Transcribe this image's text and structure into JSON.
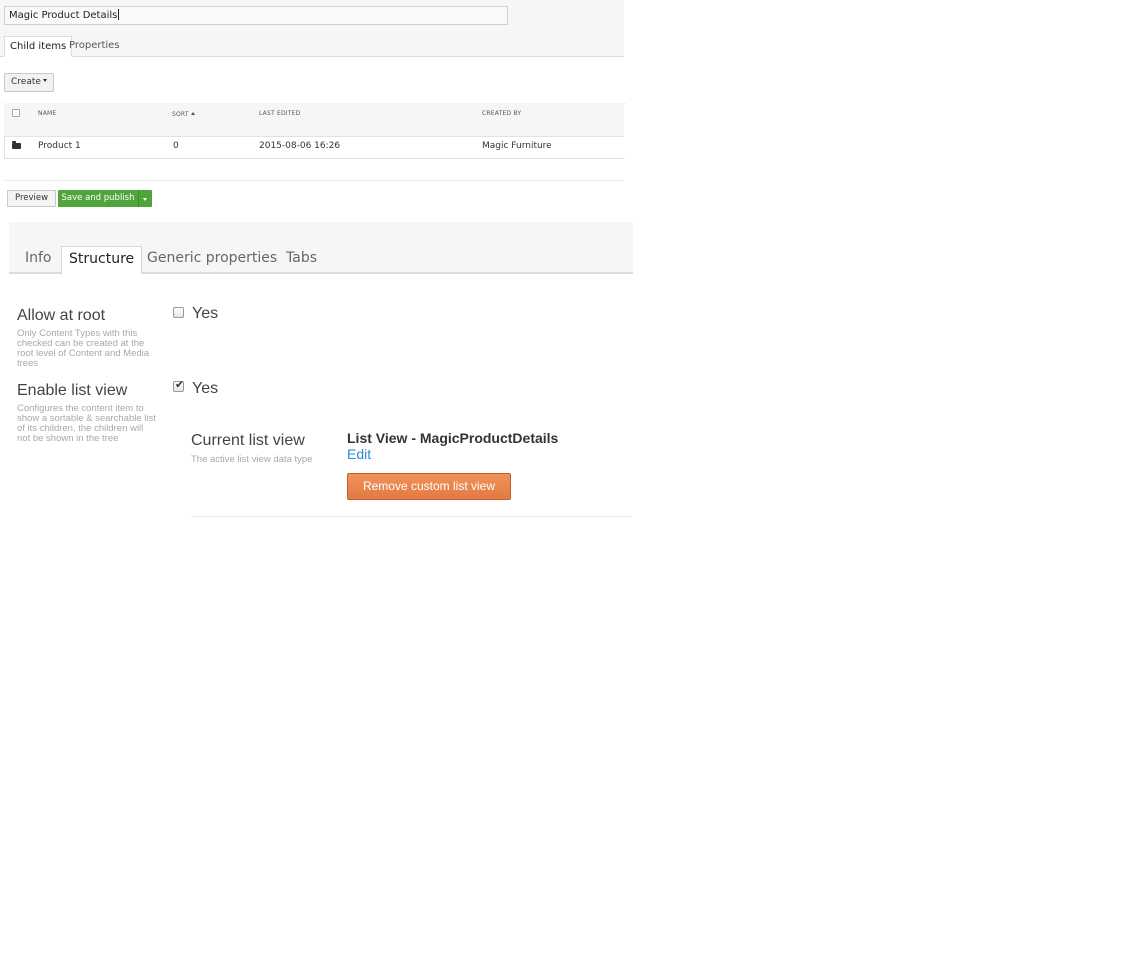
{
  "content_preview": {
    "name_value": "Magic Product Details",
    "tabs": [
      {
        "label": "Child items",
        "active": true
      },
      {
        "label": "Properties",
        "active": false
      }
    ],
    "create_label": "Create",
    "table": {
      "columns": [
        "NAME",
        "SORT",
        "LAST EDITED",
        "CREATED BY"
      ],
      "rows": [
        {
          "icon": "folder-icon",
          "name": "Product 1",
          "sort": "0",
          "last_edited": "2015-08-06 16:26",
          "created_by": "Magic Furniture"
        }
      ]
    },
    "preview_label": "Preview",
    "save_publish_label": "Save and publish"
  },
  "editor": {
    "tabs": [
      {
        "label": "Info",
        "active": false
      },
      {
        "label": "Structure",
        "active": true
      },
      {
        "label": "Generic properties",
        "active": false
      },
      {
        "label": "Tabs",
        "active": false
      }
    ],
    "allow_at_root": {
      "label": "Allow at root",
      "description": "Only Content Types with this checked can be created at the root level of Content and Media trees",
      "checked": false,
      "option_label": "Yes"
    },
    "enable_list_view": {
      "label": "Enable list view",
      "description": "Configures the content item to show a sortable & searchable list of its children, the children will not be shown in the tree",
      "checked": true,
      "option_label": "Yes"
    },
    "current_list_view": {
      "label": "Current list view",
      "description": "The active list view data type",
      "value": "List View - MagicProductDetails",
      "edit_label": "Edit",
      "remove_label": "Remove custom list view"
    }
  },
  "colors": {
    "publish_green": "#50a43c",
    "remove_orange": "#e8834b",
    "edit_link_blue": "#2a8bd5"
  }
}
